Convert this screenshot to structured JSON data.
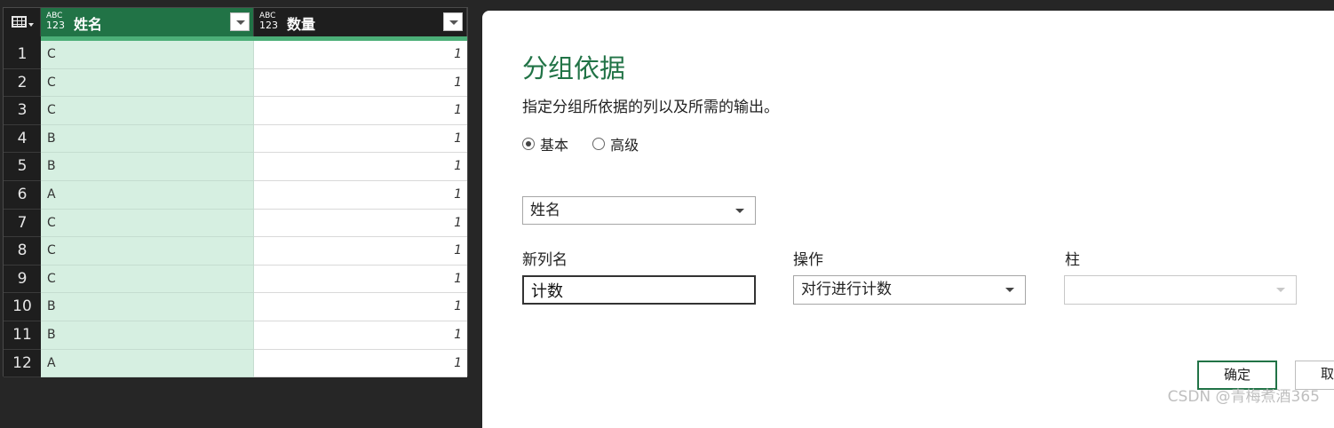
{
  "grid": {
    "type_icon": {
      "top": "ABC",
      "bottom": "123"
    },
    "columns": [
      {
        "name": "姓名"
      },
      {
        "name": "数量"
      }
    ],
    "rows": [
      {
        "num": "1",
        "name": "C",
        "qty": "1"
      },
      {
        "num": "2",
        "name": "C",
        "qty": "1"
      },
      {
        "num": "3",
        "name": "C",
        "qty": "1"
      },
      {
        "num": "4",
        "name": "B",
        "qty": "1"
      },
      {
        "num": "5",
        "name": "B",
        "qty": "1"
      },
      {
        "num": "6",
        "name": "A",
        "qty": "1"
      },
      {
        "num": "7",
        "name": "C",
        "qty": "1"
      },
      {
        "num": "8",
        "name": "C",
        "qty": "1"
      },
      {
        "num": "9",
        "name": "C",
        "qty": "1"
      },
      {
        "num": "10",
        "name": "B",
        "qty": "1"
      },
      {
        "num": "11",
        "name": "B",
        "qty": "1"
      },
      {
        "num": "12",
        "name": "A",
        "qty": "1"
      }
    ]
  },
  "dialog": {
    "title": "分组依据",
    "subtitle": "指定分组所依据的列以及所需的输出。",
    "radio": {
      "basic": "基本",
      "advanced": "高级",
      "selected": "basic"
    },
    "group_by_value": "姓名",
    "labels": {
      "new_col": "新列名",
      "operation": "操作",
      "column": "柱"
    },
    "new_col_value": "计数",
    "operation_value": "对行进行计数",
    "column_value": "",
    "buttons": {
      "ok": "确定",
      "cancel": "取"
    }
  },
  "watermark": "CSDN @青梅煮酒365",
  "colors": {
    "accent": "#217346",
    "selected_col_bg": "#d6efe1"
  }
}
